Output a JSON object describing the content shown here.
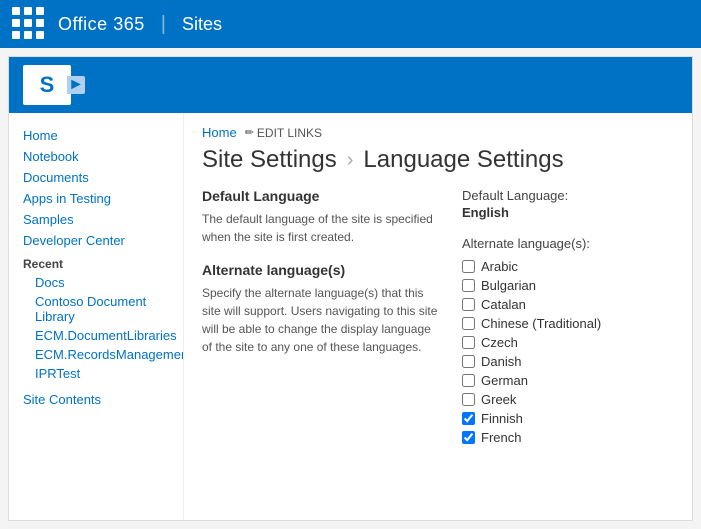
{
  "topbar": {
    "title": "Office 365",
    "divider": "|",
    "sites": "Sites"
  },
  "breadcrumb": {
    "home": "Home",
    "edit_links": "EDIT LINKS"
  },
  "page_title": {
    "site_settings": "Site Settings",
    "arrow": "›",
    "language_settings": "Language Settings"
  },
  "default_language_section": {
    "title": "Default Language",
    "description": "The default language of the site is specified when the site is first created."
  },
  "default_language_value": {
    "label": "Default Language:",
    "value": "English"
  },
  "alternate_language_section": {
    "title": "Alternate language(s)",
    "description": "Specify the alternate language(s) that this site will support. Users navigating to this site will be able to change the display language of the site to any one of these languages."
  },
  "alternate_languages": {
    "label": "Alternate language(s):",
    "languages": [
      {
        "name": "Arabic",
        "checked": false
      },
      {
        "name": "Bulgarian",
        "checked": false
      },
      {
        "name": "Catalan",
        "checked": false
      },
      {
        "name": "Chinese (Traditional)",
        "checked": false
      },
      {
        "name": "Czech",
        "checked": false
      },
      {
        "name": "Danish",
        "checked": false
      },
      {
        "name": "German",
        "checked": false
      },
      {
        "name": "Greek",
        "checked": false
      },
      {
        "name": "Finnish",
        "checked": true
      },
      {
        "name": "French",
        "checked": true
      }
    ]
  },
  "sidebar": {
    "links": [
      {
        "label": "Home",
        "indent": false
      },
      {
        "label": "Notebook",
        "indent": false
      },
      {
        "label": "Documents",
        "indent": false
      },
      {
        "label": "Apps in Testing",
        "indent": false
      },
      {
        "label": "Samples",
        "indent": false
      },
      {
        "label": "Developer Center",
        "indent": false
      }
    ],
    "recent_label": "Recent",
    "recent_links": [
      {
        "label": "Docs"
      },
      {
        "label": "Contoso Document Library"
      },
      {
        "label": "ECM.DocumentLibraries"
      },
      {
        "label": "ECM.RecordsManagement"
      },
      {
        "label": "IPRTest"
      }
    ],
    "bottom_link": "Site Contents"
  }
}
